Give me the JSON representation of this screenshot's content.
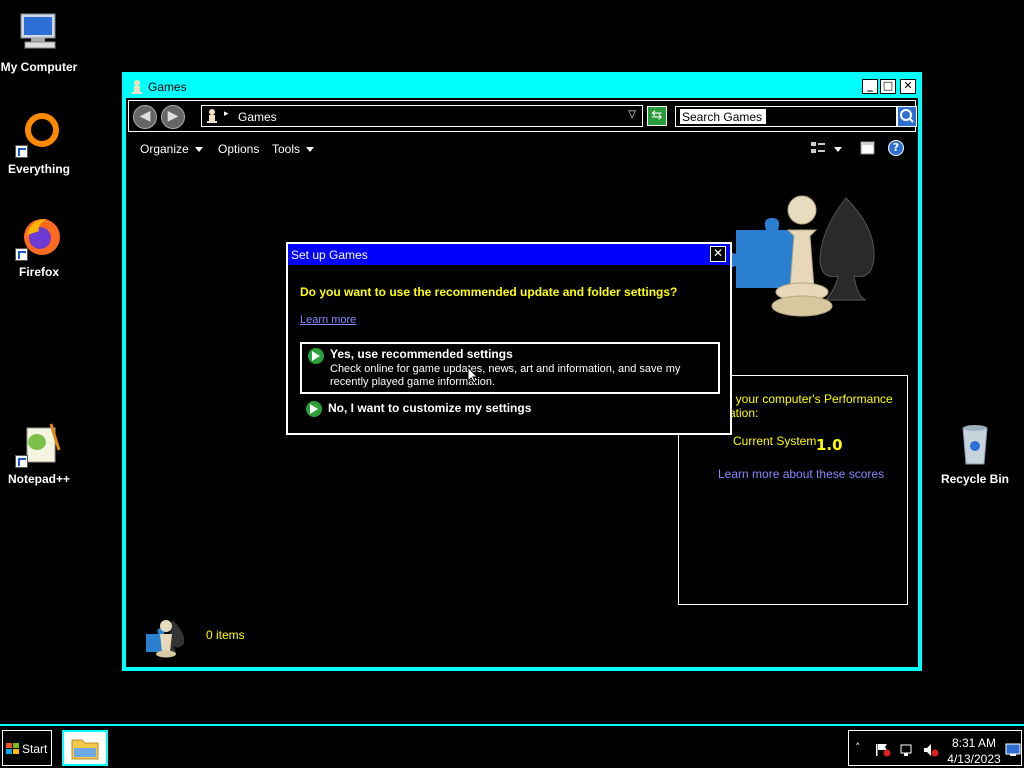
{
  "desktop": {
    "icons": [
      {
        "label": "My Computer"
      },
      {
        "label": "Everything"
      },
      {
        "label": "Firefox"
      },
      {
        "label": "Notepad++"
      },
      {
        "label": "Recycle Bin"
      }
    ]
  },
  "window": {
    "title": "Games",
    "address": {
      "crumb": "Games"
    },
    "search": {
      "value": "Search Games"
    },
    "toolbar": {
      "organize": "Organize",
      "options": "Options",
      "tools": "Tools"
    },
    "perf": {
      "text": "t your computer's Performance ation:",
      "system_label": "Current System",
      "score": "1.0",
      "link": "Learn more about these scores"
    },
    "status": {
      "items": "0 items"
    }
  },
  "dialog": {
    "title": "Set up Games",
    "question": "Do you want to use the recommended update and folder settings?",
    "learn_more": "Learn more",
    "option1": {
      "title": "Yes, use recommended settings",
      "desc": "Check online for game updates, news, art and information, and save my recently played game information."
    },
    "option2": {
      "title": "No, I want to customize my settings"
    }
  },
  "taskbar": {
    "start": "Start",
    "time": "8:31 AM",
    "date": "4/13/2023"
  },
  "colors": {
    "accent": "#00ffff",
    "dialog_title": "#0000ff",
    "highlight_text": "#ffff00",
    "link": "#8888ff"
  }
}
